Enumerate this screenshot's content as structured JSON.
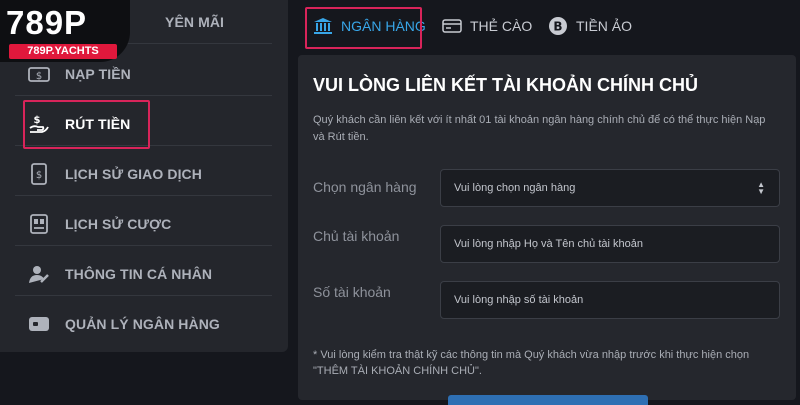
{
  "logo": {
    "brand": "789P",
    "domain": "789P.YACHTS",
    "partial_item": "YÊN MÃI"
  },
  "sidebar": {
    "items": [
      {
        "label": "NẠP TIỀN",
        "icon": "deposit-icon"
      },
      {
        "label": "RÚT TIỀN",
        "icon": "withdraw-money-icon",
        "active": true
      },
      {
        "label": "LỊCH SỬ GIAO DỊCH",
        "icon": "transaction-history-icon"
      },
      {
        "label": "LỊCH SỬ CƯỢC",
        "icon": "bet-history-icon"
      },
      {
        "label": "THÔNG TIN CÁ NHÂN",
        "icon": "user-info-icon"
      },
      {
        "label": "QUẢN LÝ NGÂN HÀNG",
        "icon": "bank-card-icon"
      }
    ]
  },
  "tabs": [
    {
      "label": "NGÂN HÀNG",
      "icon": "bank-icon",
      "active": true
    },
    {
      "label": "THẺ CÀO",
      "icon": "card-icon"
    },
    {
      "label": "TIỀN ẢO",
      "icon": "bitcoin-icon"
    }
  ],
  "panel": {
    "title": "VUI LÒNG LIÊN KẾT TÀI KHOẢN CHÍNH CHỦ",
    "description": "Quý khách cần liên kết với ít nhất 01 tài khoản ngân hàng chính chủ để có thể thực hiện Nạp và Rút tiền.",
    "fields": [
      {
        "label": "Chọn ngân hàng",
        "placeholder": "Vui lòng chọn ngân hàng"
      },
      {
        "label": "Chủ tài khoản",
        "placeholder": "Vui lòng nhập Họ và Tên chủ tài khoản"
      },
      {
        "label": "Số tài khoản",
        "placeholder": "Vui lòng nhập số tài khoản"
      }
    ],
    "note": "* Vui lòng kiểm tra thật kỹ các thông tin mà Quý khách vừa nhập trước khi thực hiện chọn \"THÊM TÀI KHOẢN CHÍNH CHỦ\"."
  },
  "colors": {
    "accent": "#38a6e8",
    "highlight": "#d8245a",
    "brand_red": "#e0183c",
    "background": "#15171d"
  }
}
